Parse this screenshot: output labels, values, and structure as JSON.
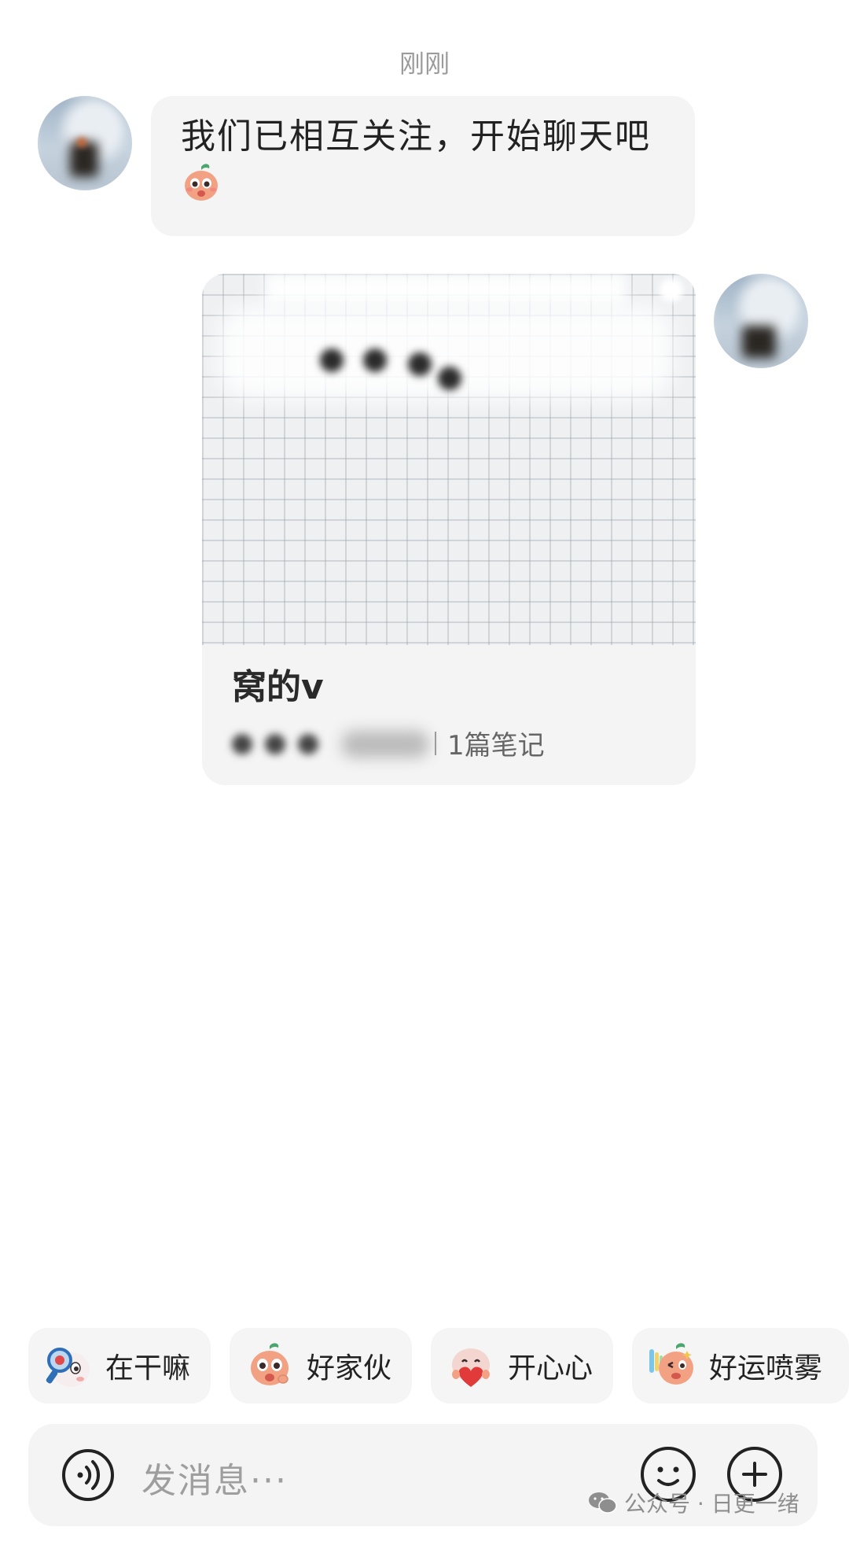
{
  "chat": {
    "timestamp": "刚刚",
    "system_message": "我们已相互关注，开始聊天吧"
  },
  "shared_card": {
    "title": "窝的v",
    "meta_suffix": "1篇笔记"
  },
  "quick_replies": [
    {
      "label": "在干嘛",
      "sticker": "peach-magnifier-sticker"
    },
    {
      "label": "好家伙",
      "sticker": "peach-surprised-sticker"
    },
    {
      "label": "开心心",
      "sticker": "peach-heart-sticker"
    },
    {
      "label": "好运喷雾",
      "sticker": "peach-spray-sticker"
    }
  ],
  "input": {
    "placeholder": "发消息···"
  },
  "watermark": {
    "text": "公众号 · 日更一绪"
  },
  "colors": {
    "bubble_bg": "#f4f4f4",
    "peach": "#f3a183",
    "leaf": "#4ba56e"
  }
}
